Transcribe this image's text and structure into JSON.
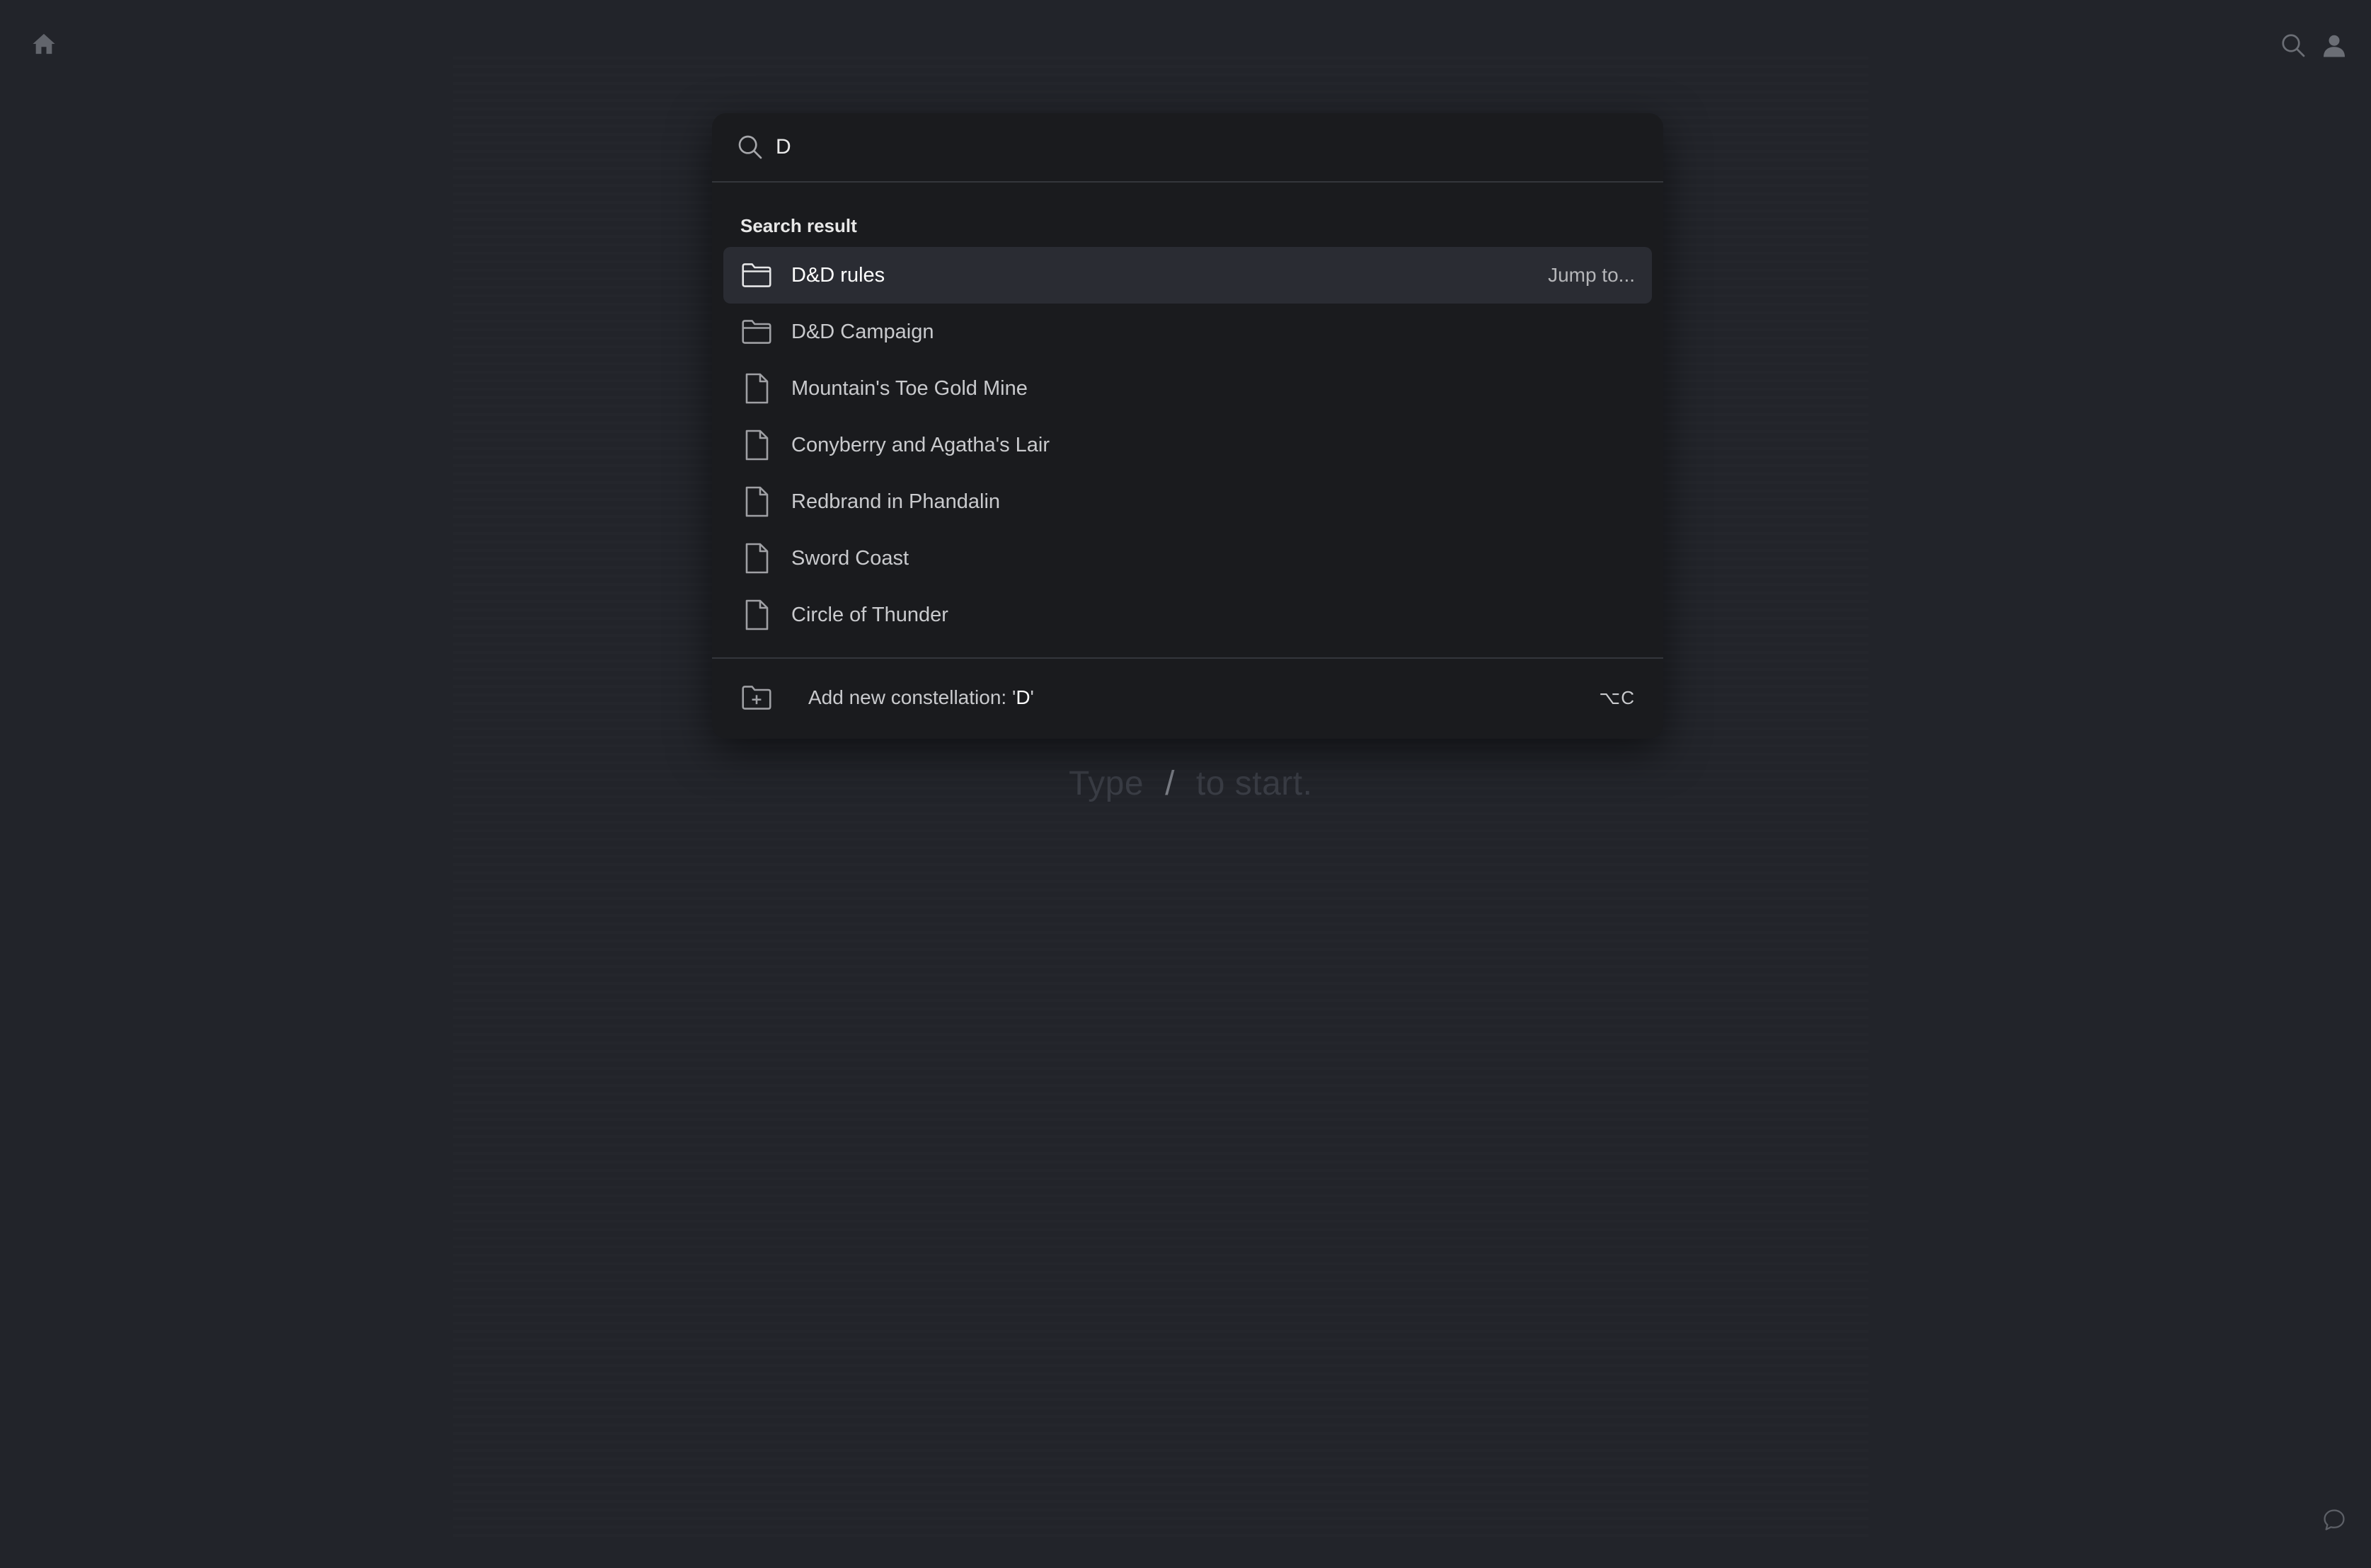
{
  "search": {
    "value": "D",
    "section_label": "Search result"
  },
  "results": [
    {
      "label": "D&D rules",
      "type": "folder",
      "active": true,
      "action": "Jump to..."
    },
    {
      "label": "D&D Campaign",
      "type": "folder"
    },
    {
      "label": "Mountain's Toe Gold Mine",
      "type": "document"
    },
    {
      "label": "Conyberry and Agatha's Lair",
      "type": "document"
    },
    {
      "label": "Redbrand in Phandalin",
      "type": "document"
    },
    {
      "label": "Sword Coast",
      "type": "document"
    },
    {
      "label": "Circle of Thunder",
      "type": "document"
    }
  ],
  "add_new": {
    "prefix": "Add new constellation: '",
    "query": "D",
    "suffix": "'",
    "shortcut": "⌥C"
  },
  "hint": {
    "before": "Type",
    "slash": "/",
    "after": "to start."
  },
  "icons": {
    "home": "home-icon",
    "search": "search-icon",
    "user": "user-icon",
    "chat": "chat-icon",
    "folder": "folder-icon",
    "document": "document-icon",
    "add_folder": "folder-plus-icon"
  },
  "colors": {
    "background": "#22242a",
    "palette": "#1a1b1e",
    "active_row": "#2a2c33"
  }
}
